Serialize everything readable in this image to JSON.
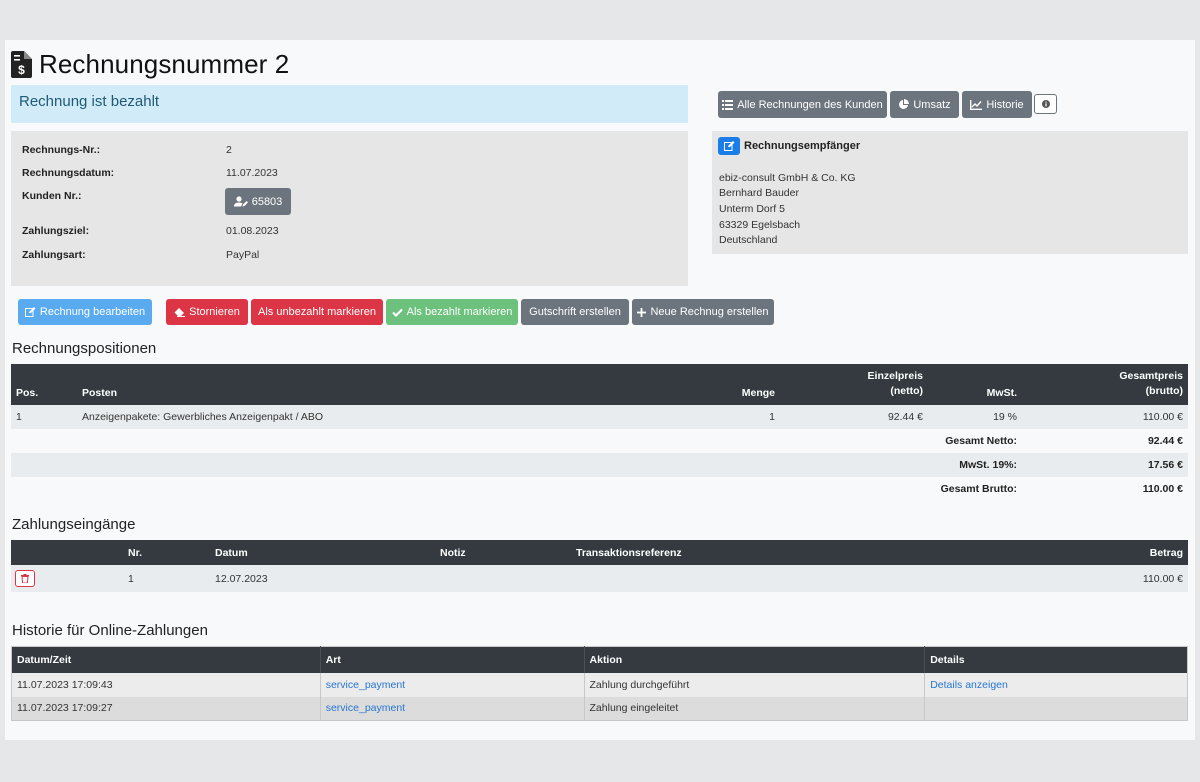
{
  "title": "Rechnungsnummer 2",
  "status_alert": "Rechnung ist bezahlt",
  "invoice_info": [
    {
      "label": "Rechnungs-Nr.:",
      "value": "2"
    },
    {
      "label": "Rechnungsdatum:",
      "value": "11.07.2023"
    },
    {
      "label": "Kunden Nr.:",
      "value": "65803"
    },
    {
      "label": "Zahlungsziel:",
      "value": "01.08.2023"
    },
    {
      "label": "Zahlungsart:",
      "value": "PayPal"
    }
  ],
  "top_buttons": {
    "all_invoices": "Alle Rechnungen des Kunden",
    "revenue": "Umsatz",
    "history": "Historie"
  },
  "recipient": {
    "title": "Rechnungsempfänger",
    "lines": [
      "ebiz-consult GmbH & Co. KG",
      "Bernhard Bauder",
      "Unterm Dorf 5",
      "63329 Egelsbach",
      "Deutschland"
    ]
  },
  "actions": {
    "edit": "Rechnung bearbeiten",
    "cancel": "Stornieren",
    "mark_unpaid": "Als unbezahlt markieren",
    "mark_paid": "Als bezahlt markieren",
    "credit_note": "Gutschrift erstellen",
    "new_invoice": "Neue Rechnug erstellen"
  },
  "positions": {
    "title": "Rechnungspositionen",
    "headers": {
      "pos": "Pos.",
      "item": "Posten",
      "qty": "Menge",
      "unit_price_1": "Einzelpreis",
      "unit_price_2": "(netto)",
      "vat": "MwSt.",
      "total_1": "Gesamtpreis",
      "total_2": "(brutto)"
    },
    "rows": [
      {
        "pos": "1",
        "item": "Anzeigenpakete: Gewerbliches Anzeigenpakt / ABO",
        "qty": "1",
        "unit_price": "92.44 €",
        "vat": "19 %",
        "total": "110.00 €"
      }
    ],
    "totals": [
      {
        "label": "Gesamt Netto:",
        "value": "92.44 €"
      },
      {
        "label": "MwSt. 19%:",
        "value": "17.56 €"
      },
      {
        "label": "Gesamt Brutto:",
        "value": "110.00 €"
      }
    ]
  },
  "payments": {
    "title": "Zahlungseingänge",
    "headers": {
      "nr": "Nr.",
      "date": "Datum",
      "note": "Notiz",
      "ref": "Transaktionsreferenz",
      "amount": "Betrag"
    },
    "rows": [
      {
        "nr": "1",
        "date": "12.07.2023",
        "note": "",
        "ref": "",
        "amount": "110.00 €"
      }
    ]
  },
  "online_history": {
    "title": "Historie für Online-Zahlungen",
    "headers": {
      "datetime": "Datum/Zeit",
      "type": "Art",
      "action": "Aktion",
      "details": "Details"
    },
    "rows": [
      {
        "datetime": "11.07.2023 17:09:43",
        "type": "service_payment",
        "action": "Zahlung durchgeführt",
        "details": "Details anzeigen"
      },
      {
        "datetime": "11.07.2023 17:09:27",
        "type": "service_payment",
        "action": "Zahlung eingeleitet",
        "details": ""
      }
    ]
  },
  "icons": [
    "invoice-dollar-icon",
    "list-icon",
    "pie-chart-icon",
    "line-chart-icon",
    "info-icon",
    "edit-icon",
    "user-edit-icon",
    "eraser-icon",
    "check-icon",
    "plus-icon",
    "trash-icon"
  ],
  "colors": {
    "dark_header": "#343a40",
    "danger": "#dc3545",
    "success": "#6cc17c",
    "primary": "#1b7ee8",
    "secondary": "#6c757d",
    "alert_bg": "#d1ecf8"
  }
}
